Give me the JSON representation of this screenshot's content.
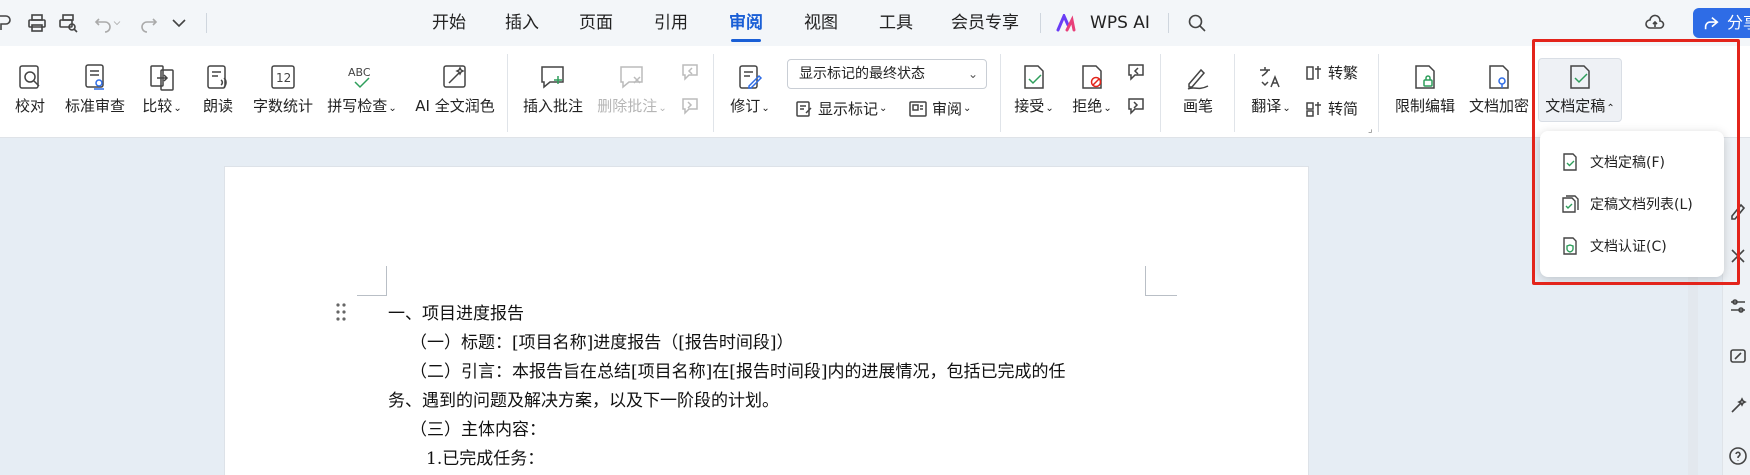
{
  "menu": {
    "tabs": [
      "开始",
      "插入",
      "页面",
      "引用",
      "审阅",
      "视图",
      "工具",
      "会员专享"
    ],
    "active_tab": "审阅",
    "wps_ai": "WPS AI",
    "share": "分享"
  },
  "ribbon": {
    "proofread": "校对",
    "standard_review": "标准审查",
    "compare": "比较",
    "read_aloud": "朗读",
    "word_count": "字数统计",
    "word_count_icon_text": "12",
    "spell_check": "拼写检查",
    "spell_icon_text": "ABC",
    "ai_polish": "AI 全文润色",
    "insert_comment": "插入批注",
    "delete_comment": "删除批注",
    "revise": "修订",
    "markup_state": "显示标记的最终状态",
    "show_markup": "显示标记",
    "review": "审阅",
    "accept": "接受",
    "reject": "拒绝",
    "pen": "画笔",
    "translate": "翻译",
    "to_traditional": "转繁",
    "to_simplified": "转简",
    "restrict_edit": "限制编辑",
    "encrypt": "文档加密",
    "finalize": "文档定稿"
  },
  "dropdown": {
    "items": [
      "文档定稿(F)",
      "定稿文档列表(L)",
      "文档认证(C)"
    ]
  },
  "document": {
    "lines": [
      "一、项目进度报告",
      "（一）标题：[项目名称]进度报告（[报告时间段]）",
      "（二）引言：本报告旨在总结[项目名称]在[报告时间段]内的进展情况，包括已完成的任",
      "务、遇到的问题及解决方案，以及下一阶段的计划。",
      "（三）主体内容：",
      "1.已完成任务："
    ]
  }
}
